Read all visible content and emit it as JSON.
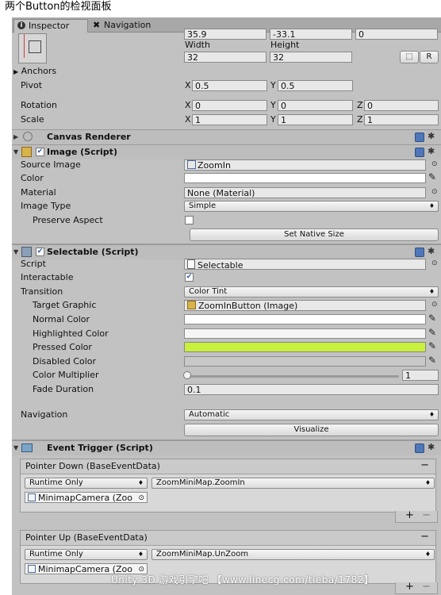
{
  "caption": "两个Button的检视面板",
  "tabs": {
    "inspector": "Inspector",
    "navigation": "Navigation"
  },
  "rect": {
    "pos_x": "35.9",
    "pos_y": "-33.1",
    "pos_z": "0",
    "width_label": "Width",
    "height_label": "Height",
    "width": "32",
    "height": "32",
    "r_button": "R",
    "anchors": "Anchors",
    "pivot": "Pivot",
    "pivot_x": "0.5",
    "pivot_y": "0.5",
    "rotation": "Rotation",
    "rot_x": "0",
    "rot_y": "0",
    "rot_z": "0",
    "scale": "Scale",
    "scale_x": "1",
    "scale_y": "1",
    "scale_z": "1",
    "ax_x": "X",
    "ax_y": "Y",
    "ax_z": "Z"
  },
  "canvas_renderer": {
    "title": "Canvas Renderer"
  },
  "image": {
    "title": "Image (Script)",
    "source_image_label": "Source Image",
    "source_image": "ZoomIn",
    "color_label": "Color",
    "material_label": "Material",
    "material": "None (Material)",
    "image_type_label": "Image Type",
    "image_type": "Simple",
    "preserve_aspect_label": "Preserve Aspect",
    "set_native_size": "Set Native Size"
  },
  "selectable": {
    "title": "Selectable (Script)",
    "script_label": "Script",
    "script": "Selectable",
    "interactable_label": "Interactable",
    "transition_label": "Transition",
    "transition": "Color Tint",
    "target_graphic_label": "Target Graphic",
    "target_graphic": "ZoomInButton (Image)",
    "normal_color_label": "Normal Color",
    "highlighted_color_label": "Highlighted Color",
    "pressed_color_label": "Pressed Color",
    "disabled_color_label": "Disabled Color",
    "color_multiplier_label": "Color Multiplier",
    "color_multiplier": "1",
    "fade_duration_label": "Fade Duration",
    "fade_duration": "0.1",
    "navigation_label": "Navigation",
    "navigation": "Automatic",
    "visualize": "Visualize",
    "colors": {
      "normal": "#ffffff",
      "highlighted": "#f5f5f5",
      "pressed": "#c8f03c",
      "disabled": "#c8c8c8"
    }
  },
  "event_trigger": {
    "title": "Event Trigger (Script)",
    "events": [
      {
        "header": "Pointer Down (BaseEventData)",
        "mode": "Runtime Only",
        "function": "ZoomMiniMap.ZoomIn",
        "object": "MinimapCamera (Zoo"
      },
      {
        "header": "Pointer Up (BaseEventData)",
        "mode": "Runtime Only",
        "function": "ZoomMiniMap.UnZoom",
        "object": "MinimapCamera (Zoo"
      }
    ],
    "add": "+",
    "remove": "−",
    "collapse": "−"
  },
  "watermark": "Unity 3D 游戏引擎吧 【www.linecg.com/tieba/1782】"
}
